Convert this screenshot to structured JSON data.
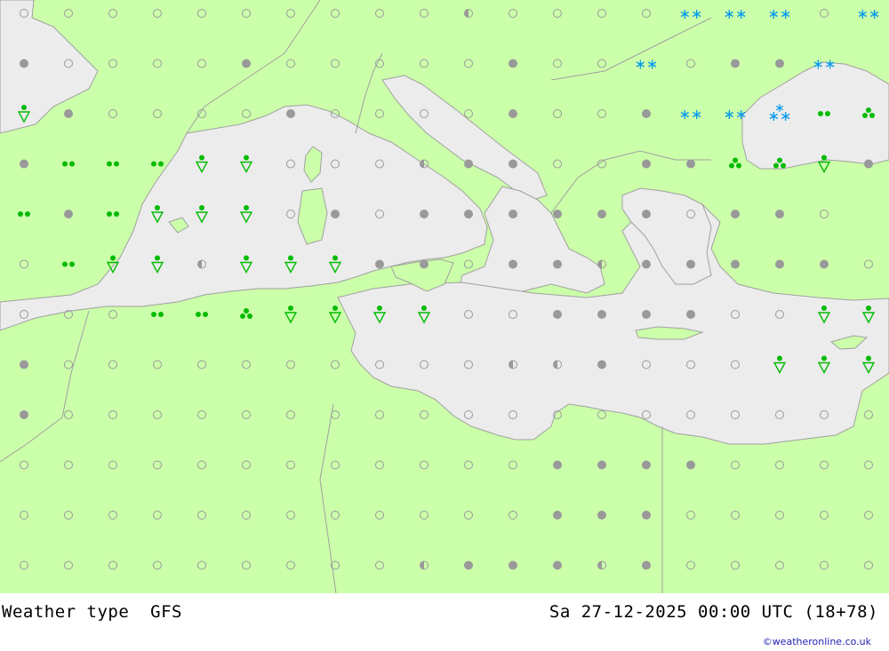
{
  "title": "Weather type",
  "model": "GFS",
  "valid_time": "Sa 27-12-2025 00:00 UTC (18+78)",
  "credit": "©weatheronline.co.uk",
  "colors": {
    "land": "#ccffaa",
    "sea": "#ececec",
    "border": "#a0a0a0",
    "symbol_grey": "#999999",
    "symbol_green": "#00bb00",
    "symbol_blue": "#0099ee"
  },
  "grid": {
    "columns": 20,
    "rows": 12
  },
  "legend_symbols": {
    "o": "clear-sky",
    "h": "partly-cloudy",
    "c": "cloudy",
    "d": "drizzle",
    "r": "rain",
    "s": "rain-shower",
    "S": "snow",
    "X": "snow-shower"
  },
  "weather_grid": [
    "oooooooooohooooSSSoS",
    "coooocooooocooSoccS/",
    "scoooocoooocoocSSXdt",
    "cddd ssooohccooccttsco",
    "dcdsssococcccccocco",
    "odsshsssccocchccccco",
    "ooo ddtssssooccccoosss",
    "coooooooooohhcooosss",
    "coooooooooooooooooooo",
    "ooooooooooooccccoooo",
    "oooooooooooocccooooo",
    "ooooooooohccchcooooo"
  ]
}
